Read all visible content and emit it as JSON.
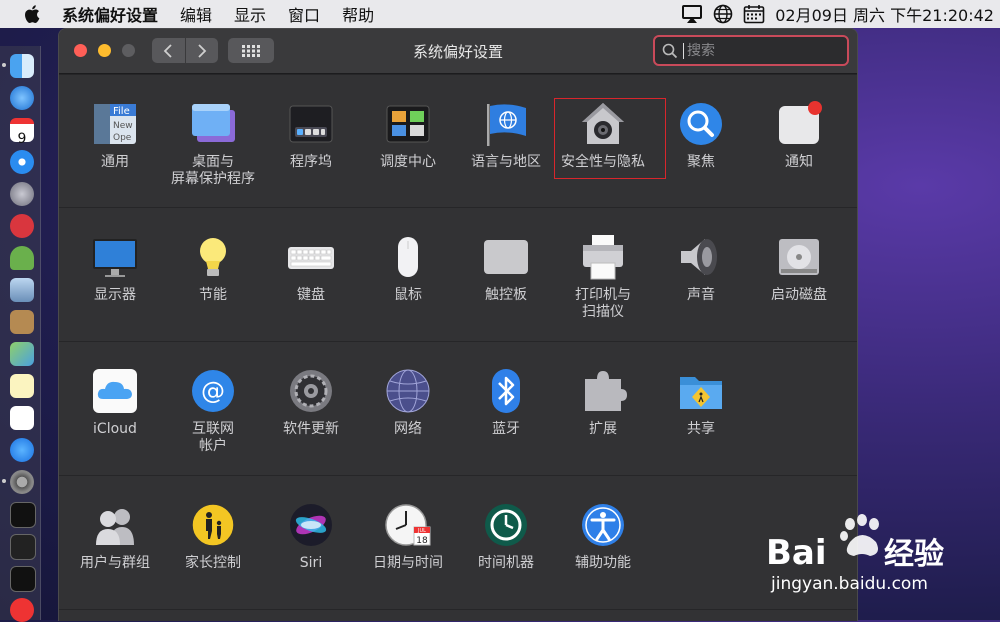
{
  "menubar": {
    "app": "系统偏好设置",
    "items": [
      "编辑",
      "显示",
      "窗口",
      "帮助"
    ],
    "clock": "02月09日 周六 下午21:20:42"
  },
  "window": {
    "title": "系统偏好设置",
    "search_placeholder": "搜索"
  },
  "sections": [
    {
      "panes": [
        {
          "label": "通用",
          "icon": "general-icon"
        },
        {
          "label": "桌面与\n屏幕保护程序",
          "icon": "desktop-screensaver-icon"
        },
        {
          "label": "程序坞",
          "icon": "dock-icon"
        },
        {
          "label": "调度中心",
          "icon": "mission-control-icon"
        },
        {
          "label": "语言与地区",
          "icon": "language-region-icon"
        },
        {
          "label": "安全性与隐私",
          "icon": "security-privacy-icon",
          "highlighted": true
        },
        {
          "label": "聚焦",
          "icon": "spotlight-icon"
        },
        {
          "label": "通知",
          "icon": "notifications-icon"
        }
      ]
    },
    {
      "panes": [
        {
          "label": "显示器",
          "icon": "displays-icon"
        },
        {
          "label": "节能",
          "icon": "energy-saver-icon"
        },
        {
          "label": "键盘",
          "icon": "keyboard-icon"
        },
        {
          "label": "鼠标",
          "icon": "mouse-icon"
        },
        {
          "label": "触控板",
          "icon": "trackpad-icon"
        },
        {
          "label": "打印机与\n扫描仪",
          "icon": "printer-scanner-icon"
        },
        {
          "label": "声音",
          "icon": "sound-icon"
        },
        {
          "label": "启动磁盘",
          "icon": "startup-disk-icon"
        }
      ]
    },
    {
      "panes": [
        {
          "label": "iCloud",
          "icon": "icloud-icon"
        },
        {
          "label": "互联网\n帐户",
          "icon": "internet-accounts-icon"
        },
        {
          "label": "软件更新",
          "icon": "software-update-icon"
        },
        {
          "label": "网络",
          "icon": "network-icon"
        },
        {
          "label": "蓝牙",
          "icon": "bluetooth-icon"
        },
        {
          "label": "扩展",
          "icon": "extensions-icon"
        },
        {
          "label": "共享",
          "icon": "sharing-icon"
        }
      ]
    },
    {
      "panes": [
        {
          "label": "用户与群组",
          "icon": "users-groups-icon"
        },
        {
          "label": "家长控制",
          "icon": "parental-controls-icon"
        },
        {
          "label": "Siri",
          "icon": "siri-icon"
        },
        {
          "label": "日期与时间",
          "icon": "date-time-icon"
        },
        {
          "label": "时间机器",
          "icon": "time-machine-icon"
        },
        {
          "label": "辅助功能",
          "icon": "accessibility-icon"
        }
      ]
    }
  ],
  "icon_text": {
    "general_file": "File",
    "general_new": "New",
    "general_open": "Ope",
    "calendar_day": "9",
    "datetime_month": "JUL",
    "datetime_day": "18"
  },
  "watermark": {
    "brand": "Bai",
    "brand2": "经验",
    "url": "jingyan.baidu.com"
  },
  "colors": {
    "accent_highlight": "#d8262c",
    "search_focus": "#c94a5a"
  }
}
